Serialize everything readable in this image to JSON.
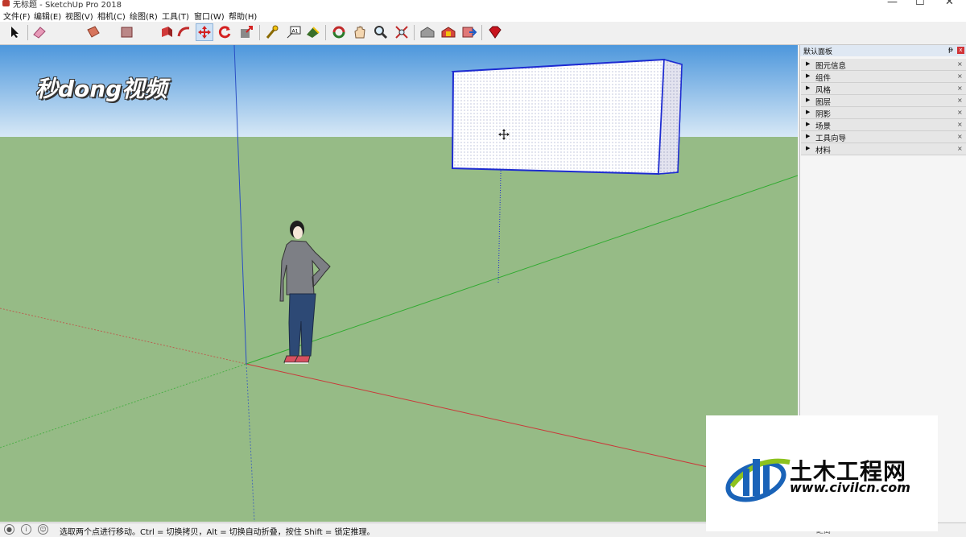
{
  "window": {
    "title": "无标题 - SketchUp Pro 2018",
    "minimize": "—",
    "maximize": "☐",
    "close": "✕"
  },
  "menu": [
    "文件(F)",
    "编辑(E)",
    "视图(V)",
    "相机(C)",
    "绘图(R)",
    "工具(T)",
    "窗口(W)",
    "帮助(H)"
  ],
  "toolbar": {
    "icons": [
      "select-arrow-icon",
      "eraser-icon",
      "paint-bucket-icon",
      "line-pencil-icon",
      "rectangle-icon",
      "push-pull-icon",
      "follow-me-icon",
      "move-icon",
      "rotate-icon",
      "scale-icon",
      "tape-measure-icon",
      "text-icon",
      "paint-icon",
      "orbit-icon",
      "pan-icon",
      "zoom-icon",
      "zoom-extents-icon",
      "warehouse-icon",
      "extension-warehouse-icon",
      "send-to-layout-icon",
      "ruby-icon"
    ],
    "active_tool": "move-icon",
    "text_tool_glyph": "A1"
  },
  "panel": {
    "title": "默认面板",
    "pin_glyph": "ᵽ",
    "close_glyph": "x",
    "tray_arrow": "▶",
    "tray_close": "×",
    "trays": [
      "图元信息",
      "组件",
      "风格",
      "图层",
      "阴影",
      "场景",
      "工具向导",
      "材料"
    ]
  },
  "status": {
    "icons": [
      "geo-location-icon",
      "info-icon",
      "user-icon"
    ],
    "message": "选取两个点进行移动。Ctrl = 切换拷贝，Alt = 切换自动折叠，按住 Shift = 锁定推理。",
    "measurements_label": "距离"
  },
  "watermarks": {
    "top_logo": "秒dong视频",
    "bottom_cn": "土木工程网",
    "bottom_url": "www.civilcn.com"
  },
  "colors": {
    "sky_top": "#4d97dc",
    "sky_bottom": "#d7e8f6",
    "ground": "#96bb86",
    "axis_red": "#c93a3a",
    "axis_green": "#2faa2f",
    "axis_blue": "#2a4fc4",
    "selection_blue": "#1d2bd1",
    "active_tool_bg": "#cfe2f5",
    "panel_header": "#dfe8f3",
    "panel_close": "#d13438"
  }
}
